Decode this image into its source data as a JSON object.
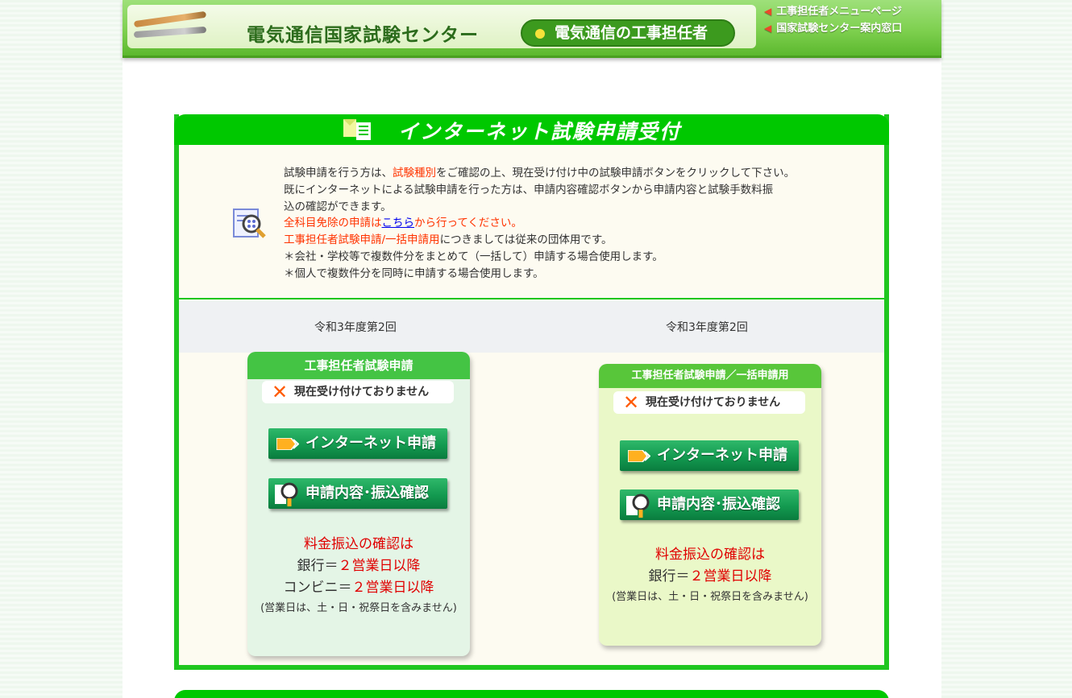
{
  "header": {
    "site_title": "電気通信国家試験センター",
    "section": "電気通信の工事担任者",
    "links": [
      "工事担任者メニューページ",
      "国家試験センター案内窓口"
    ]
  },
  "main": {
    "title": "インターネット試験申請受付",
    "info": {
      "line1_a": "試験申請を行う方は、",
      "line1_red": "試験種別",
      "line1_b": "をご確認の上、現在受け付け中の試験申請ボタンをクリックして下さい。",
      "line2": "既にインターネットによる試験申請を行った方は、申請内容確認ボタンから申請内容と試験手数料振",
      "line3": "込の確認ができます。",
      "line4_red_a": "全科目免除の申請は",
      "line4_link": "こちら",
      "line4_red_b": "から行ってください。",
      "line5_red": "工事担任者試験申請/一括申請用",
      "line5_b": "につきましては従来の団体用です。",
      "line6": "＊会社・学校等で複数件分をまとめて（一括して）申請する場合使用します。",
      "line7": "＊個人で複数件分を同時に申請する場合使用します。"
    },
    "rounds": [
      "令和3年度第2回",
      "令和3年度第2回"
    ],
    "cards": [
      {
        "title": "工事担任者試験申請",
        "status": "現在受け付けておりません",
        "apply_button": "インターネット申請",
        "confirm_button": "申請内容･振込確認",
        "fee_heading": "料金振込の確認は",
        "bank_label": "銀行＝",
        "bank_value": "２営業日以降",
        "conv_label": "コンビニ＝",
        "conv_value": "２営業日以降",
        "note": "(営業日は、土・日・祝祭日を含みません)"
      },
      {
        "title": "工事担任者試験申請／一括申請用",
        "status": "現在受け付けておりません",
        "apply_button": "インターネット申請",
        "confirm_button": "申請内容･振込確認",
        "fee_heading": "料金振込の確認は",
        "bank_label": "銀行＝",
        "bank_value": "２営業日以降",
        "note": "(営業日は、土・日・祝祭日を含みません)"
      }
    ]
  },
  "colors": {
    "green_accent": "#00c800",
    "alert_red": "#ff3300",
    "button_green": "#139a50"
  }
}
